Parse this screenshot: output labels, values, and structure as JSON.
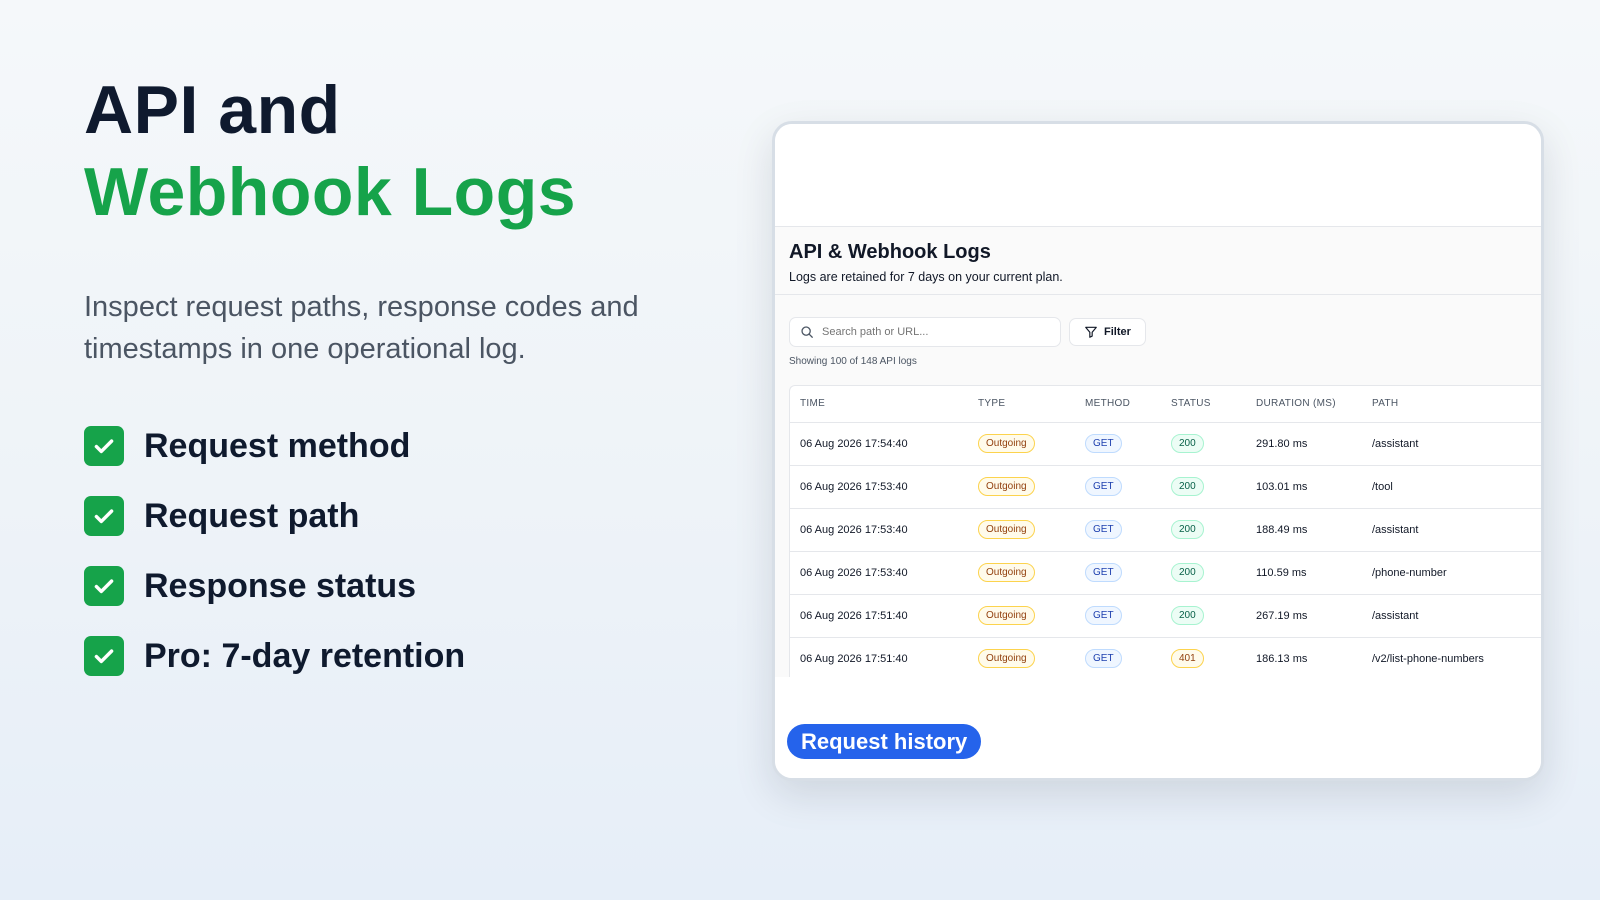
{
  "hero": {
    "title_line1": "API and",
    "title_line2": "Webhook Logs",
    "subtitle": "Inspect request paths, response codes and timestamps in one operational log.",
    "features": [
      {
        "label": "Request method"
      },
      {
        "label": "Request path"
      },
      {
        "label": "Response status"
      },
      {
        "label": "Pro: 7-day retention"
      }
    ]
  },
  "colors": {
    "accent_green": "#16a34a",
    "primary_blue": "#2563eb",
    "title_dark": "#0f1a2e"
  },
  "panel": {
    "title": "API & Webhook Logs",
    "subtitle": "Logs are retained for 7 days on your current plan.",
    "search_placeholder": "Search path or URL...",
    "filter_label": "Filter",
    "count_text": "Showing 100 of 148 API logs",
    "columns": [
      "TIME",
      "TYPE",
      "METHOD",
      "STATUS",
      "DURATION (MS)",
      "PATH"
    ],
    "rows": [
      {
        "time": "06 Aug 2026 17:54:40",
        "type": "Outgoing",
        "method": "GET",
        "status": "200",
        "duration": "291.80 ms",
        "path": "/assistant"
      },
      {
        "time": "06 Aug 2026 17:53:40",
        "type": "Outgoing",
        "method": "GET",
        "status": "200",
        "duration": "103.01 ms",
        "path": "/tool"
      },
      {
        "time": "06 Aug 2026 17:53:40",
        "type": "Outgoing",
        "method": "GET",
        "status": "200",
        "duration": "188.49 ms",
        "path": "/assistant"
      },
      {
        "time": "06 Aug 2026 17:53:40",
        "type": "Outgoing",
        "method": "GET",
        "status": "200",
        "duration": "110.59 ms",
        "path": "/phone-number"
      },
      {
        "time": "06 Aug 2026 17:51:40",
        "type": "Outgoing",
        "method": "GET",
        "status": "200",
        "duration": "267.19 ms",
        "path": "/assistant"
      },
      {
        "time": "06 Aug 2026 17:51:40",
        "type": "Outgoing",
        "method": "GET",
        "status": "401",
        "duration": "186.13 ms",
        "path": "/v2/list-phone-numbers"
      }
    ],
    "history_button": "Request history"
  }
}
